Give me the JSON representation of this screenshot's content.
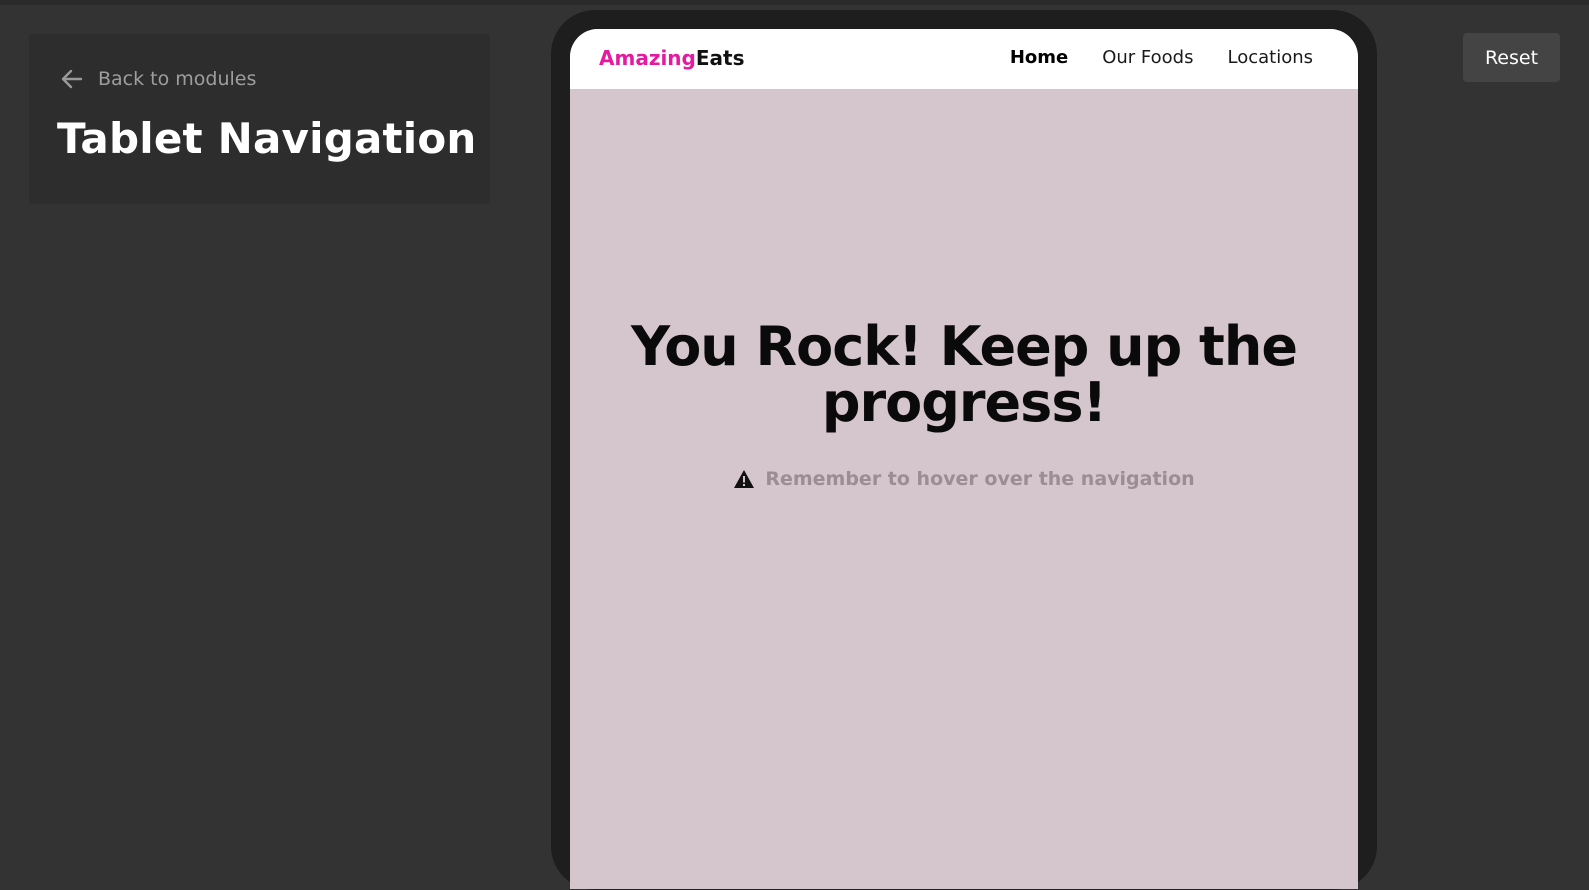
{
  "sidebar": {
    "back_label": "Back to modules",
    "title": "Tablet Navigation"
  },
  "toolbar": {
    "reset_label": "Reset"
  },
  "site": {
    "brand_part1": "Amazing",
    "brand_part2": "Eats",
    "nav_links": [
      "Home",
      "Our Foods",
      "Locations"
    ],
    "active_link": "Home"
  },
  "hero": {
    "title": "You Rock! Keep up the progress!",
    "hint_icon": "warning-icon",
    "hint": "Remember to hover over the navigation"
  },
  "colors": {
    "page_bg": "#333333",
    "panel_bg": "#2d2d2d",
    "tablet_frame": "#1e1e1e",
    "screen_bg": "#d5c5cd",
    "brand_accent": "#e51aa0",
    "hint_text": "#9c8d95"
  }
}
